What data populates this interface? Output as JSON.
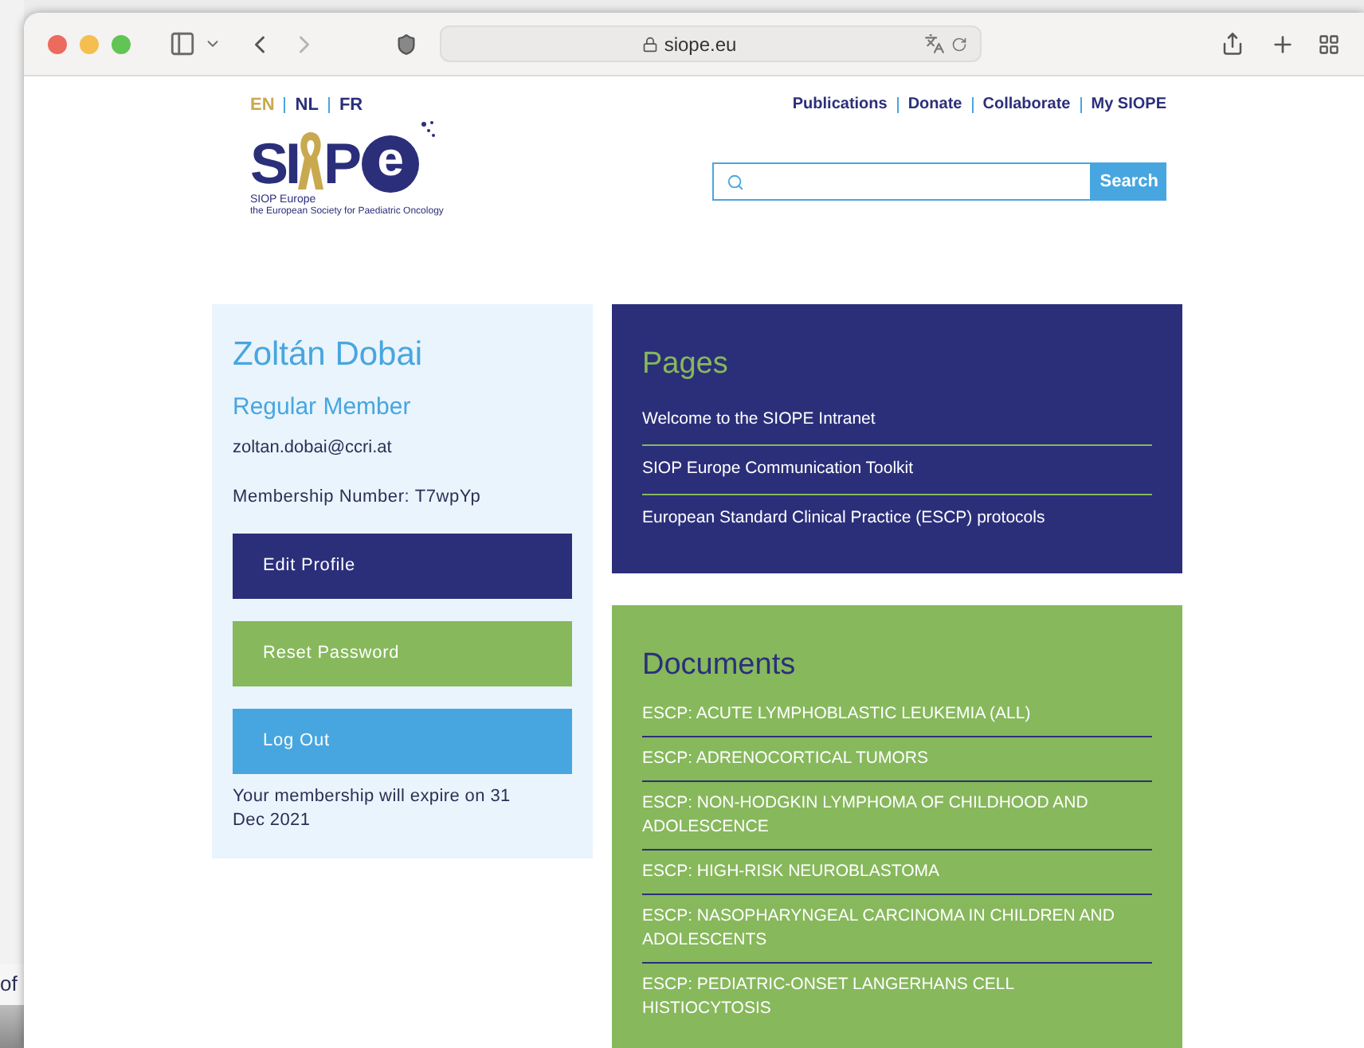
{
  "desktop": {
    "background_text": "of"
  },
  "browser": {
    "address": "siope.eu"
  },
  "header": {
    "languages": [
      {
        "label": "EN",
        "selected": true
      },
      {
        "label": "NL",
        "selected": false
      },
      {
        "label": "FR",
        "selected": false
      }
    ],
    "logo": {
      "text_left": "SI",
      "text_right": "P",
      "emblem_letter": "e",
      "line1": "SIOP Europe",
      "line2": "the European Society for Paediatric Oncology"
    },
    "nav": [
      "Publications",
      "Donate",
      "Collaborate",
      "My SIOPE"
    ],
    "search": {
      "button": "Search"
    }
  },
  "profile": {
    "name": "Zoltán Dobai",
    "membership": "Regular Member",
    "email": "zoltan.dobai@ccri.at",
    "number": "Membership Number: T7wpYp",
    "buttons": [
      {
        "label": "Edit Profile",
        "color": "#2b2f7a"
      },
      {
        "label": "Reset Password",
        "color": "#87b85c"
      },
      {
        "label": "Log Out",
        "color": "#47a6e0"
      }
    ],
    "expiry": "Your membership will expire on 31 Dec 2021"
  },
  "pages": {
    "title": "Pages",
    "items": [
      "Welcome to the SIOPE Intranet",
      "SIOP Europe Communication Toolkit",
      "European Standard Clinical Practice (ESCP) protocols"
    ]
  },
  "documents": {
    "title": "Documents",
    "items": [
      "ESCP: ACUTE LYMPHOBLASTIC LEUKEMIA (ALL)",
      "ESCP: ADRENOCORTICAL TUMORS",
      "ESCP: NON-HODGKIN LYMPHOMA OF CHILDHOOD AND ADOLESCENCE",
      "ESCP: HIGH-RISK NEUROBLASTOMA",
      "ESCP: NASOPHARYNGEAL CARCINOMA IN CHILDREN AND ADOLESCENTS",
      "ESCP: PEDIATRIC-ONSET LANGERHANS CELL HISTIOCYTOSIS"
    ]
  }
}
